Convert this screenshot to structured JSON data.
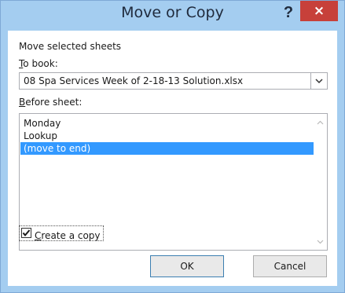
{
  "window": {
    "title": "Move or Copy",
    "help_label": "?",
    "close_label": "×"
  },
  "form": {
    "move_label": "Move selected sheets",
    "to_book_label_first": "T",
    "to_book_label_rest": "o book:",
    "to_book_value": "08 Spa Services Week of 2-18-13 Solution.xlsx",
    "before_sheet_label_first": "B",
    "before_sheet_label_rest": "efore sheet:",
    "sheets": [
      "Monday",
      "Lookup",
      "(move to end)"
    ],
    "selected_index": 2,
    "create_copy_label_first": "C",
    "create_copy_label_rest": "reate a copy",
    "create_copy_checked": true
  },
  "buttons": {
    "ok": "OK",
    "cancel": "Cancel"
  },
  "colors": {
    "title_bar": "#a4cdf0",
    "close_button": "#c7403a",
    "selection": "#3399ff"
  },
  "icons": {
    "dropdown": "chevron-down-icon",
    "scroll_up": "chevron-up-icon",
    "scroll_down": "chevron-down-icon",
    "checkbox": "checkmark-icon"
  }
}
